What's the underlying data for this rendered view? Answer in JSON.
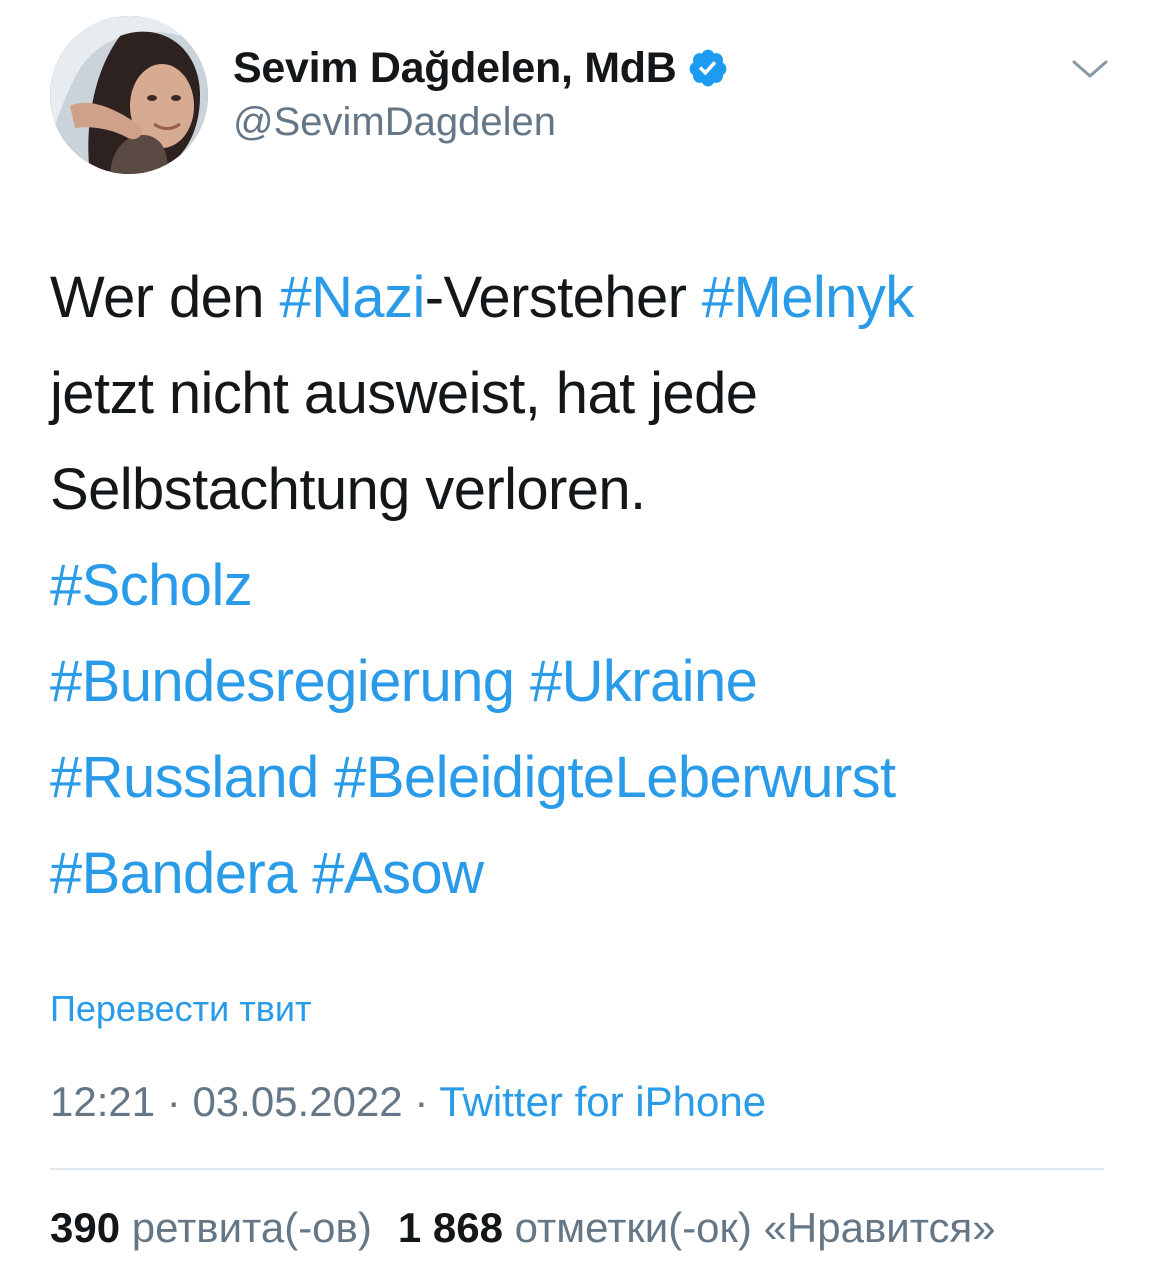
{
  "header": {
    "display_name": "Sevim Dağdelen, MdB",
    "handle": "@SevimDagdelen",
    "verified_icon": "verified-badge-icon",
    "menu_icon": "chevron-down-icon"
  },
  "tweet": {
    "line1": {
      "t1": "Wer den ",
      "h1": "#Nazi",
      "t2": "-Versteher ",
      "h2": "#Melnyk"
    },
    "line2": "jetzt nicht ausweist, hat jede",
    "line3": "Selbstachtung verloren.",
    "line4": {
      "h1": "#Scholz"
    },
    "line5": {
      "h1": "#Bundesregierung",
      "h2": "#Ukraine"
    },
    "line6": {
      "h1": "#Russland",
      "h2": "#BeleidigteLeberwurst"
    },
    "line7": {
      "h1": "#Bandera",
      "h2": "#Asow"
    }
  },
  "translate_label": "Перевести твит",
  "meta": {
    "time": "12:21",
    "separator": " · ",
    "date": "03.05.2022",
    "source": "Twitter for iPhone"
  },
  "stats": {
    "retweets_count": "390",
    "retweets_label": "ретвита(-ов)",
    "likes_count": "1 868",
    "likes_label": "отметки(-ок) «Нравится»"
  },
  "colors": {
    "link": "#2a9be8",
    "text": "#14171a",
    "muted": "#657786",
    "divider": "#e1e8ed"
  }
}
